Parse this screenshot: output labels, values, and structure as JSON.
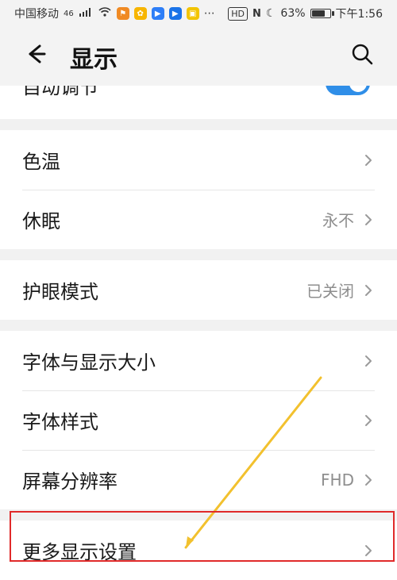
{
  "status_bar": {
    "carrier": "中国移动",
    "network": "46",
    "battery_percent": "63%",
    "time": "下午1:56",
    "hd": "HD",
    "nfc": "N"
  },
  "header": {
    "title": "显示"
  },
  "settings": {
    "partial_item": {
      "label": "自动调节"
    },
    "section1": {
      "items": [
        {
          "label": "色温",
          "value": ""
        },
        {
          "label": "休眠",
          "value": "永不"
        }
      ]
    },
    "section2": {
      "items": [
        {
          "label": "护眼模式",
          "value": "已关闭"
        }
      ]
    },
    "section3": {
      "items": [
        {
          "label": "字体与显示大小",
          "value": ""
        },
        {
          "label": "字体样式",
          "value": ""
        },
        {
          "label": "屏幕分辨率",
          "value": "FHD"
        }
      ]
    },
    "section4": {
      "items": [
        {
          "label": "更多显示设置",
          "value": ""
        }
      ]
    }
  },
  "colors": {
    "accent": "#2f8ee8",
    "highlight": "#e02a2a",
    "annotation_arrow": "#f2c12e"
  }
}
